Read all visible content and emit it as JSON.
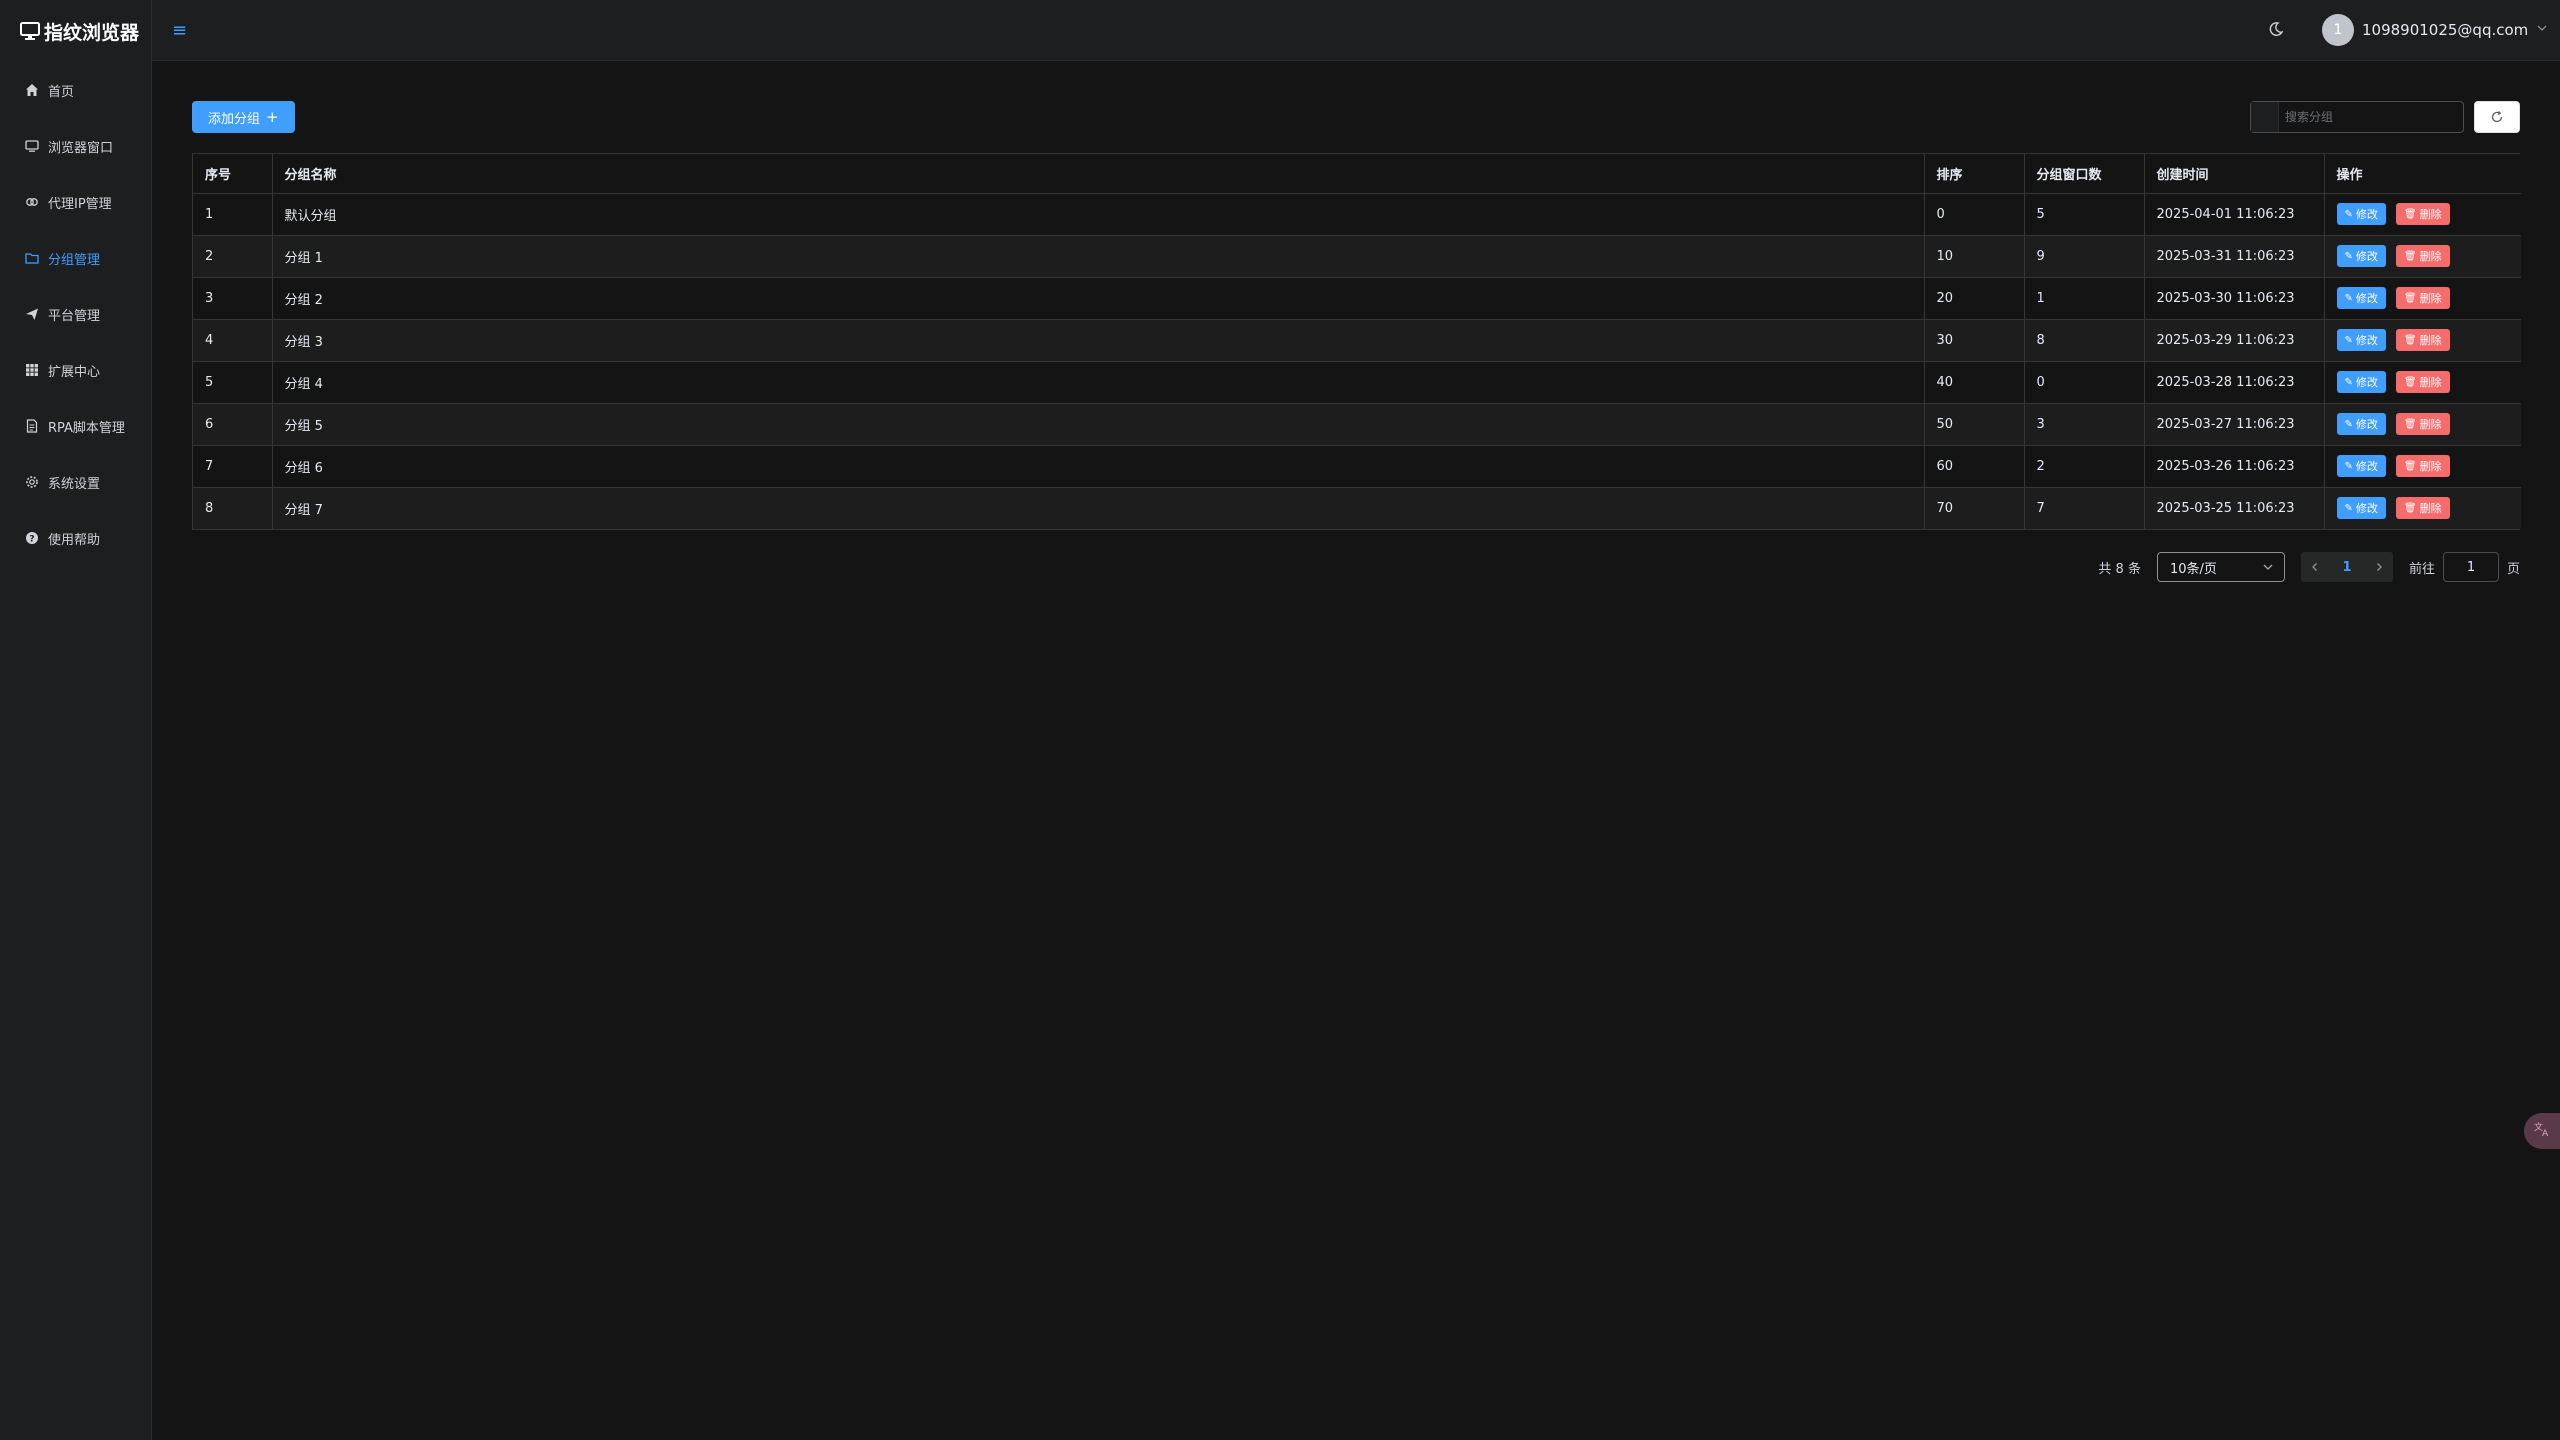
{
  "app": {
    "title": "指纹浏览器"
  },
  "sidebar": {
    "items": [
      {
        "label": "首页",
        "icon": "home-icon",
        "active": false
      },
      {
        "label": "浏览器窗口",
        "icon": "monitor-icon",
        "active": false
      },
      {
        "label": "代理IP管理",
        "icon": "link-icon",
        "active": false
      },
      {
        "label": "分组管理",
        "icon": "folder-icon",
        "active": true
      },
      {
        "label": "平台管理",
        "icon": "send-icon",
        "active": false
      },
      {
        "label": "扩展中心",
        "icon": "grid-icon",
        "active": false
      },
      {
        "label": "RPA脚本管理",
        "icon": "document-icon",
        "active": false
      },
      {
        "label": "系统设置",
        "icon": "gear-icon",
        "active": false
      },
      {
        "label": "使用帮助",
        "icon": "help-icon",
        "active": false
      }
    ]
  },
  "header": {
    "collapse_icon": "≡",
    "avatar_text": "1",
    "user_email": "1098901025@qq.com"
  },
  "toolbar": {
    "add_label": "添加分组",
    "add_plus": "+",
    "search_placeholder": "搜索分组"
  },
  "table": {
    "columns": [
      "序号",
      "分组名称",
      "排序",
      "分组窗口数",
      "创建时间",
      "操作"
    ],
    "edit_label": "修改",
    "delete_label": "删除",
    "rows": [
      {
        "index": "1",
        "name": "默认分组",
        "sort": "0",
        "windows": "5",
        "created": "2025-04-01 11:06:23"
      },
      {
        "index": "2",
        "name": "分组 1",
        "sort": "10",
        "windows": "9",
        "created": "2025-03-31 11:06:23"
      },
      {
        "index": "3",
        "name": "分组 2",
        "sort": "20",
        "windows": "1",
        "created": "2025-03-30 11:06:23"
      },
      {
        "index": "4",
        "name": "分组 3",
        "sort": "30",
        "windows": "8",
        "created": "2025-03-29 11:06:23"
      },
      {
        "index": "5",
        "name": "分组 4",
        "sort": "40",
        "windows": "0",
        "created": "2025-03-28 11:06:23"
      },
      {
        "index": "6",
        "name": "分组 5",
        "sort": "50",
        "windows": "3",
        "created": "2025-03-27 11:06:23"
      },
      {
        "index": "7",
        "name": "分组 6",
        "sort": "60",
        "windows": "2",
        "created": "2025-03-26 11:06:23"
      },
      {
        "index": "8",
        "name": "分组 7",
        "sort": "70",
        "windows": "7",
        "created": "2025-03-25 11:06:23"
      }
    ]
  },
  "pagination": {
    "total_text": "共 8 条",
    "page_size": "10条/页",
    "current_page": "1",
    "goto_label": "前往",
    "goto_value": "1",
    "page_suffix": "页"
  },
  "colors": {
    "accent": "#409eff",
    "danger": "#f56c6c",
    "background": "#141414",
    "sidebar": "#1d1e1f"
  }
}
